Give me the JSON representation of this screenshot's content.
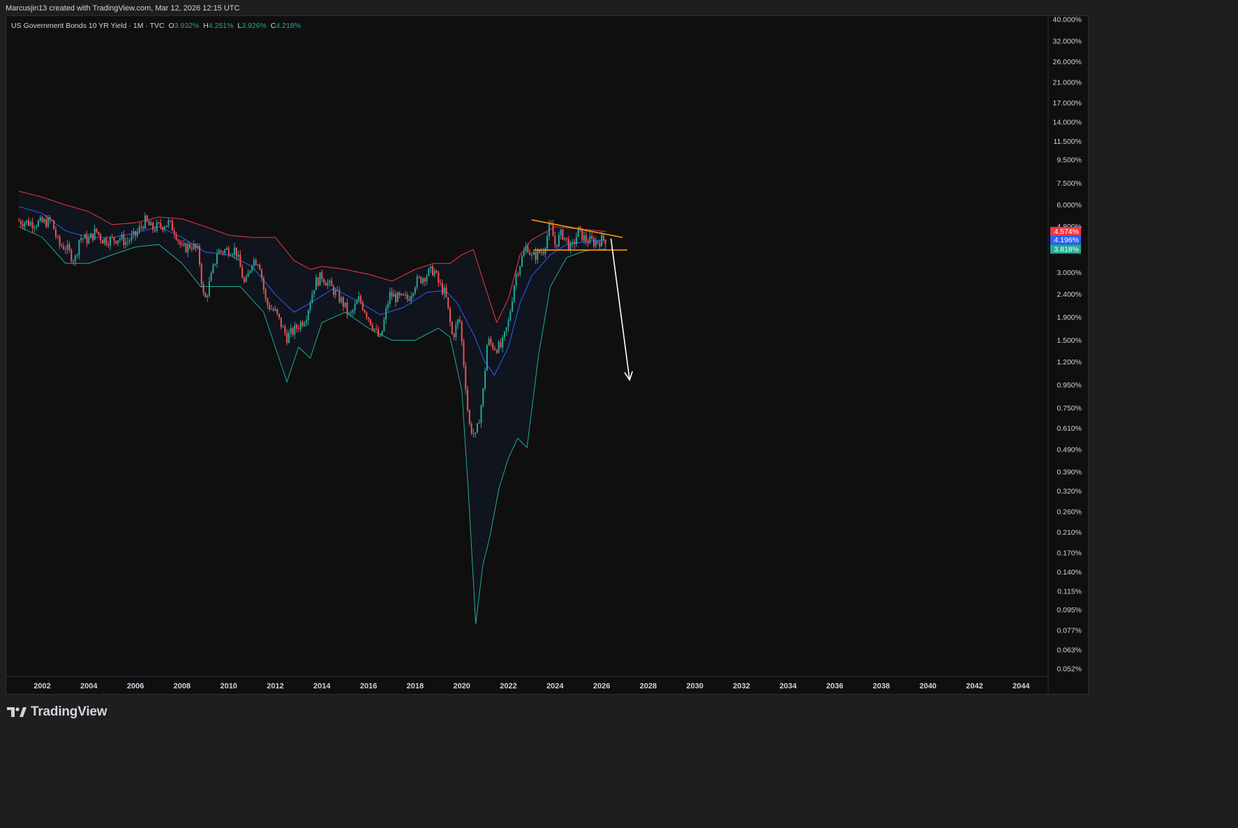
{
  "header": {
    "caption": "Marcusjin13 created with TradingView.com, Mar 12, 2026 12:15 UTC"
  },
  "legend": {
    "symbol": "US Government Bonds 10 YR Yield · 1M · TVC",
    "open_label": "O",
    "open": "3.932%",
    "high_label": "H",
    "high": "4.251%",
    "low_label": "L",
    "low": "3.926%",
    "close_label": "C",
    "close": "4.218%"
  },
  "branding": {
    "logo_text": "TradingView"
  },
  "colors": {
    "background": "#0f0f0f",
    "up": "#26a69a",
    "down": "#ef5350",
    "upper_band": "#f23645",
    "basis": "#2962ff",
    "lower_band": "#22ab94",
    "trendlines": "#ff9800",
    "arrow": "#ffffff"
  },
  "chart_data": {
    "type": "candlestick",
    "title": "US Government Bonds 10 YR Yield · 1M · TVC",
    "y_scale": "log",
    "y_ticks": [
      "40.000%",
      "32.000%",
      "26.000%",
      "21.000%",
      "17.000%",
      "14.000%",
      "11.500%",
      "9.500%",
      "7.500%",
      "6.000%",
      "4.800%",
      "3.000%",
      "2.400%",
      "1.900%",
      "1.500%",
      "1.200%",
      "0.950%",
      "0.750%",
      "0.610%",
      "0.490%",
      "0.390%",
      "0.320%",
      "0.260%",
      "0.210%",
      "0.170%",
      "0.140%",
      "0.115%",
      "0.095%",
      "0.077%",
      "0.063%",
      "0.052%"
    ],
    "x_ticks": [
      "2002",
      "2004",
      "2006",
      "2008",
      "2010",
      "2012",
      "2014",
      "2016",
      "2018",
      "2020",
      "2022",
      "2024",
      "2026",
      "2028",
      "2030",
      "2032",
      "2034",
      "2036",
      "2038",
      "2040",
      "2042",
      "2044"
    ],
    "price_labels": [
      {
        "label": "4.574%",
        "value": 4.574,
        "series": "Upper band"
      },
      {
        "label": "4.196%",
        "value": 4.196,
        "series": "Basis"
      },
      {
        "label": "3.818%",
        "value": 3.818,
        "series": "Lower band"
      }
    ],
    "closes": [
      [
        2001.0,
        5.1
      ],
      [
        2001.5,
        5.0
      ],
      [
        2002.0,
        5.0
      ],
      [
        2002.4,
        5.1
      ],
      [
        2002.7,
        4.0
      ],
      [
        2003.0,
        3.9
      ],
      [
        2003.4,
        3.4
      ],
      [
        2003.6,
        4.3
      ],
      [
        2004.0,
        4.2
      ],
      [
        2004.3,
        4.6
      ],
      [
        2004.6,
        4.2
      ],
      [
        2005.0,
        4.2
      ],
      [
        2005.3,
        4.3
      ],
      [
        2005.6,
        4.1
      ],
      [
        2006.0,
        4.4
      ],
      [
        2006.4,
        5.1
      ],
      [
        2006.7,
        4.7
      ],
      [
        2007.0,
        4.8
      ],
      [
        2007.4,
        5.0
      ],
      [
        2007.7,
        4.6
      ],
      [
        2008.0,
        3.8
      ],
      [
        2008.4,
        4.0
      ],
      [
        2008.7,
        3.7
      ],
      [
        2008.95,
        2.2
      ],
      [
        2009.3,
        3.0
      ],
      [
        2009.5,
        3.7
      ],
      [
        2010.0,
        3.8
      ],
      [
        2010.3,
        3.8
      ],
      [
        2010.7,
        2.6
      ],
      [
        2011.0,
        3.4
      ],
      [
        2011.3,
        3.4
      ],
      [
        2011.6,
        2.2
      ],
      [
        2012.0,
        2.0
      ],
      [
        2012.5,
        1.55
      ],
      [
        2012.9,
        1.7
      ],
      [
        2013.3,
        1.9
      ],
      [
        2013.7,
        2.7
      ],
      [
        2014.0,
        2.9
      ],
      [
        2014.5,
        2.5
      ],
      [
        2014.9,
        2.2
      ],
      [
        2015.2,
        1.9
      ],
      [
        2015.6,
        2.3
      ],
      [
        2016.0,
        1.9
      ],
      [
        2016.5,
        1.5
      ],
      [
        2016.9,
        2.4
      ],
      [
        2017.3,
        2.3
      ],
      [
        2017.7,
        2.3
      ],
      [
        2018.0,
        2.7
      ],
      [
        2018.4,
        2.9
      ],
      [
        2018.8,
        3.1
      ],
      [
        2019.0,
        2.7
      ],
      [
        2019.3,
        2.4
      ],
      [
        2019.6,
        1.55
      ],
      [
        2019.9,
        1.9
      ],
      [
        2020.15,
        1.0
      ],
      [
        2020.3,
        0.64
      ],
      [
        2020.6,
        0.55
      ],
      [
        2020.9,
        0.85
      ],
      [
        2021.1,
        1.5
      ],
      [
        2021.4,
        1.4
      ],
      [
        2021.7,
        1.4
      ],
      [
        2022.0,
        1.8
      ],
      [
        2022.3,
        2.9
      ],
      [
        2022.8,
        4.0
      ],
      [
        2023.0,
        3.5
      ],
      [
        2023.5,
        3.8
      ],
      [
        2023.8,
        4.9
      ],
      [
        2024.0,
        4.0
      ],
      [
        2024.3,
        4.5
      ],
      [
        2024.7,
        3.8
      ],
      [
        2025.0,
        4.6
      ],
      [
        2025.3,
        4.2
      ],
      [
        2025.7,
        4.1
      ],
      [
        2026.0,
        4.2
      ],
      [
        2026.2,
        4.218
      ]
    ],
    "upper_band": [
      [
        2001.0,
        6.9
      ],
      [
        2002.0,
        6.5
      ],
      [
        2003.0,
        6.0
      ],
      [
        2004.0,
        5.6
      ],
      [
        2005.0,
        4.9
      ],
      [
        2006.0,
        5.0
      ],
      [
        2007.0,
        5.3
      ],
      [
        2008.0,
        5.2
      ],
      [
        2009.0,
        4.8
      ],
      [
        2010.0,
        4.4
      ],
      [
        2011.0,
        4.3
      ],
      [
        2012.0,
        4.3
      ],
      [
        2012.8,
        3.4
      ],
      [
        2013.5,
        3.1
      ],
      [
        2014.0,
        3.2
      ],
      [
        2015.0,
        3.1
      ],
      [
        2016.0,
        2.95
      ],
      [
        2017.0,
        2.75
      ],
      [
        2018.0,
        3.1
      ],
      [
        2018.8,
        3.3
      ],
      [
        2019.5,
        3.3
      ],
      [
        2020.0,
        3.6
      ],
      [
        2020.5,
        3.8
      ],
      [
        2021.0,
        2.6
      ],
      [
        2021.5,
        1.8
      ],
      [
        2022.0,
        2.3
      ],
      [
        2022.5,
        3.6
      ],
      [
        2023.0,
        4.2
      ],
      [
        2024.0,
        4.8
      ],
      [
        2025.0,
        4.7
      ],
      [
        2026.2,
        4.574
      ]
    ],
    "basis": [
      [
        2001.0,
        5.9
      ],
      [
        2002.0,
        5.5
      ],
      [
        2003.0,
        4.6
      ],
      [
        2004.0,
        4.3
      ],
      [
        2005.0,
        4.3
      ],
      [
        2006.0,
        4.5
      ],
      [
        2007.0,
        4.8
      ],
      [
        2008.0,
        4.3
      ],
      [
        2009.0,
        3.7
      ],
      [
        2010.0,
        3.6
      ],
      [
        2011.0,
        3.2
      ],
      [
        2012.0,
        2.4
      ],
      [
        2012.8,
        2.0
      ],
      [
        2013.5,
        2.2
      ],
      [
        2014.5,
        2.55
      ],
      [
        2015.5,
        2.25
      ],
      [
        2016.5,
        1.95
      ],
      [
        2017.5,
        2.1
      ],
      [
        2018.5,
        2.45
      ],
      [
        2019.3,
        2.5
      ],
      [
        2019.8,
        2.2
      ],
      [
        2020.5,
        1.6
      ],
      [
        2021.0,
        1.2
      ],
      [
        2021.4,
        1.05
      ],
      [
        2022.0,
        1.4
      ],
      [
        2022.5,
        2.2
      ],
      [
        2023.0,
        2.9
      ],
      [
        2023.8,
        3.6
      ],
      [
        2024.5,
        4.0
      ],
      [
        2025.5,
        4.15
      ],
      [
        2026.2,
        4.196
      ]
    ],
    "lower_band": [
      [
        2001.0,
        4.8
      ],
      [
        2002.0,
        4.3
      ],
      [
        2003.0,
        3.3
      ],
      [
        2004.0,
        3.3
      ],
      [
        2005.0,
        3.6
      ],
      [
        2006.0,
        3.9
      ],
      [
        2007.0,
        4.0
      ],
      [
        2008.0,
        3.3
      ],
      [
        2008.8,
        2.6
      ],
      [
        2009.5,
        2.6
      ],
      [
        2010.5,
        2.6
      ],
      [
        2011.5,
        2.0
      ],
      [
        2012.5,
        0.98
      ],
      [
        2013.0,
        1.4
      ],
      [
        2013.5,
        1.25
      ],
      [
        2014.0,
        1.8
      ],
      [
        2015.0,
        2.0
      ],
      [
        2016.0,
        1.7
      ],
      [
        2017.0,
        1.5
      ],
      [
        2018.0,
        1.5
      ],
      [
        2019.0,
        1.7
      ],
      [
        2019.5,
        1.55
      ],
      [
        2020.0,
        0.9
      ],
      [
        2020.3,
        0.3
      ],
      [
        2020.6,
        0.082
      ],
      [
        2020.9,
        0.15
      ],
      [
        2021.2,
        0.2
      ],
      [
        2021.6,
        0.33
      ],
      [
        2022.0,
        0.45
      ],
      [
        2022.4,
        0.55
      ],
      [
        2022.8,
        0.5
      ],
      [
        2023.3,
        1.3
      ],
      [
        2023.8,
        2.6
      ],
      [
        2024.5,
        3.5
      ],
      [
        2025.3,
        3.75
      ],
      [
        2026.2,
        3.818
      ]
    ],
    "annotations": [
      {
        "type": "trendline",
        "from": [
          2023.0,
          5.15
        ],
        "to": [
          2026.9,
          4.3
        ]
      },
      {
        "type": "trendline",
        "from": [
          2023.1,
          3.78
        ],
        "to": [
          2027.1,
          3.78
        ]
      },
      {
        "type": "arrow",
        "from": [
          2026.4,
          4.25
        ],
        "to": [
          2027.2,
          1.0
        ]
      }
    ]
  }
}
